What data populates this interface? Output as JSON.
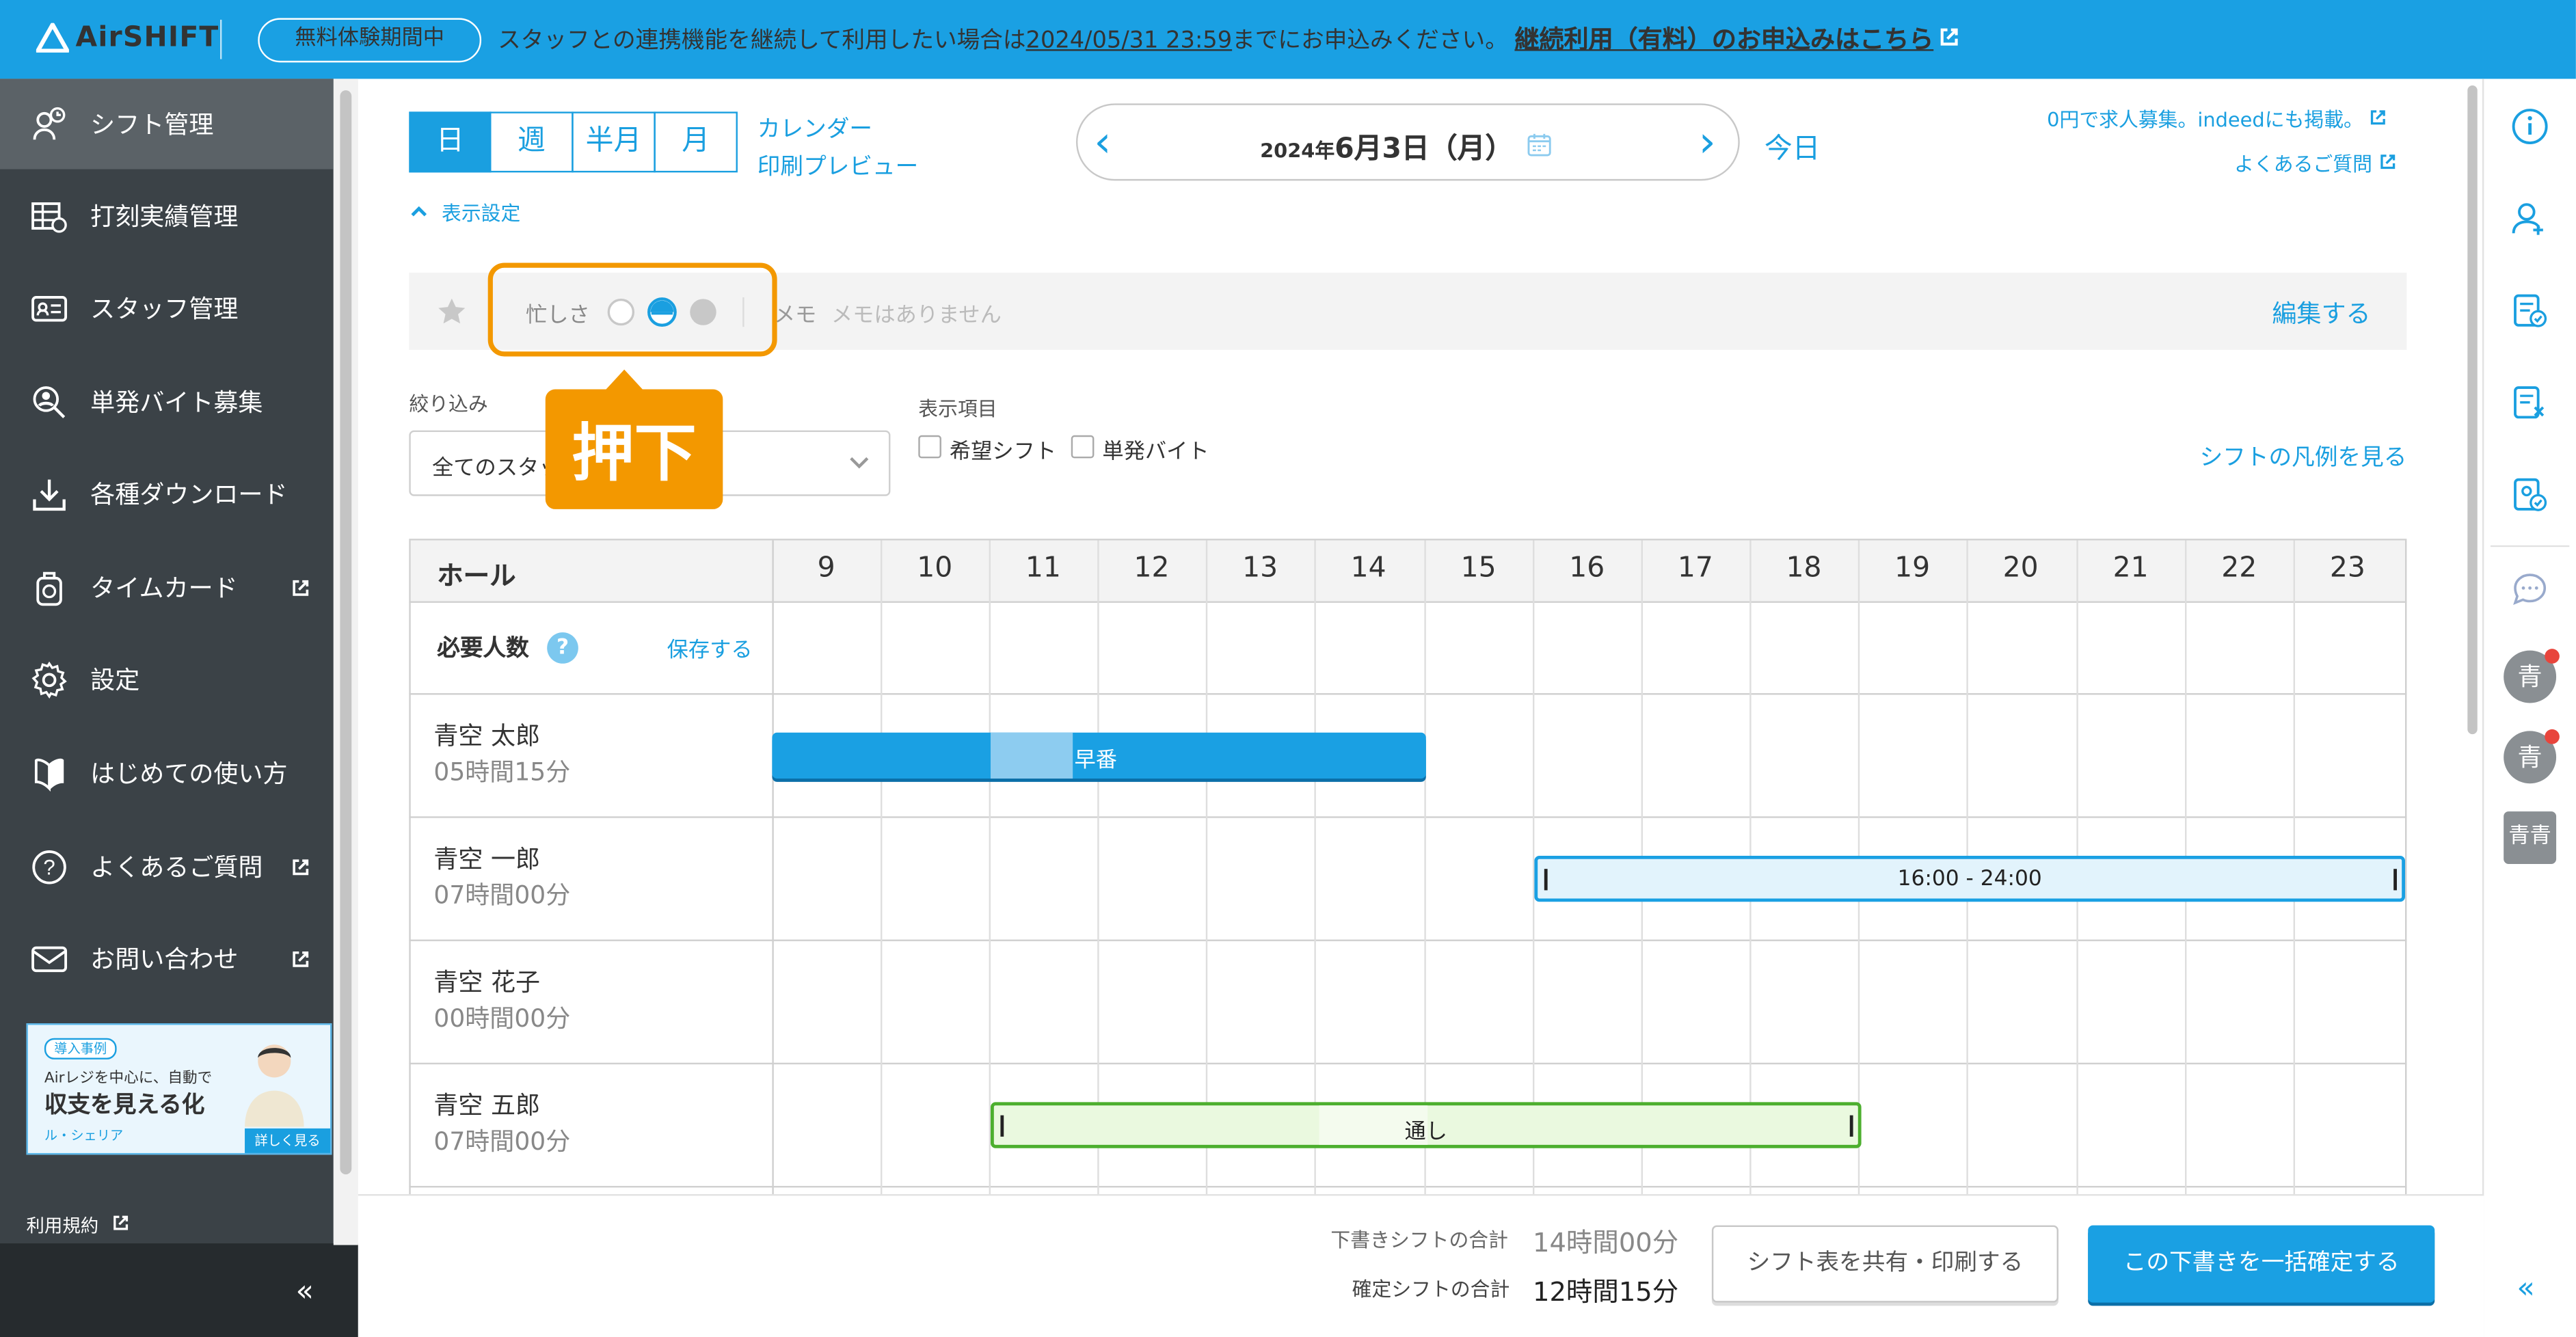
{
  "app": {
    "logo_text": "AirSHIFT"
  },
  "topbar": {
    "trial_badge": "無料体験期間中",
    "notice_prefix": "スタッフとの連携機能を継続して利用したい場合は",
    "notice_deadline": "2024/05/31 23:59",
    "notice_suffix": "までにお申込みください。",
    "notice_link": "継続利用（有料）のお申込みはこちら"
  },
  "sidebar": {
    "items": [
      {
        "label": "シフト管理",
        "icon": "shift-icon"
      },
      {
        "label": "打刻実績管理",
        "icon": "timesheet-icon"
      },
      {
        "label": "スタッフ管理",
        "icon": "staff-icon"
      },
      {
        "label": "単発バイト募集",
        "icon": "recruit-icon"
      },
      {
        "label": "各種ダウンロード",
        "icon": "download-icon"
      },
      {
        "label": "タイムカード",
        "icon": "timecard-icon"
      },
      {
        "label": "設定",
        "icon": "gear-icon"
      },
      {
        "label": "はじめての使い方",
        "icon": "beginner-icon"
      },
      {
        "label": "よくあるご質問",
        "icon": "question-icon"
      },
      {
        "label": "お問い合わせ",
        "icon": "mail-icon"
      }
    ],
    "banner": {
      "tag": "導入事例",
      "line1": "Airレジを中心に、自動で",
      "line2": "収支を見える化",
      "brand": "ル・シェリア",
      "more": "詳しく見る"
    },
    "terms": "利用規約",
    "collapse": "«"
  },
  "toolbar": {
    "view_tabs": [
      "日",
      "週",
      "半月",
      "月"
    ],
    "calendar_link_1": "カレンダー",
    "calendar_link_2": "印刷プレビュー",
    "date_year": "2024年",
    "date_main": "6月3日（月）",
    "prev": "‹",
    "next": "›",
    "today": "今日",
    "job_link": "0円で求人募集。indeedにも掲載。",
    "faq_link": "よくあるご質問",
    "display_settings": "表示設定"
  },
  "memo_bar": {
    "busy_label": "忙しさ",
    "memo_label": "メモ",
    "memo_empty": "メモはありません",
    "edit": "編集する"
  },
  "annotation": {
    "press": "押下"
  },
  "filters": {
    "filter_label": "絞り込み",
    "filter_value": "全てのスタッ",
    "display_items_label": "表示項目",
    "checkbox_1": "希望シフト",
    "checkbox_2": "単発バイト",
    "legend_link": "シフトの凡例を見る"
  },
  "grid": {
    "section": "ホール",
    "hours": [
      "9",
      "10",
      "11",
      "12",
      "13",
      "14",
      "15",
      "16",
      "17",
      "18",
      "19",
      "20",
      "21",
      "22",
      "23"
    ],
    "required_label": "必要人数",
    "save": "保存する",
    "rows": [
      {
        "name": "青空 太郎",
        "hours": "05時間15分",
        "shift_label": "早番"
      },
      {
        "name": "青空 一郎",
        "hours": "07時間00分",
        "shift_label": "16:00 - 24:00"
      },
      {
        "name": "青空 花子",
        "hours": "00時間00分",
        "shift_label": ""
      },
      {
        "name": "青空 五郎",
        "hours": "07時間00分",
        "shift_label": "通し"
      }
    ]
  },
  "footer": {
    "draft_label": "下書きシフトの合計",
    "draft_value": "14時間00分",
    "confirmed_label": "確定シフトの合計",
    "confirmed_value": "12時間15分",
    "share_button": "シフト表を共有・印刷する",
    "confirm_button": "この下書きを一括確定する"
  },
  "right_rail": {
    "avatars": [
      "青",
      "青",
      "青青"
    ],
    "collapse": "«"
  },
  "colors": {
    "brand": "#1aa0e3",
    "sidebar": "#3b4247",
    "accent": "#f39800",
    "shift_green": "#4caf2e"
  }
}
